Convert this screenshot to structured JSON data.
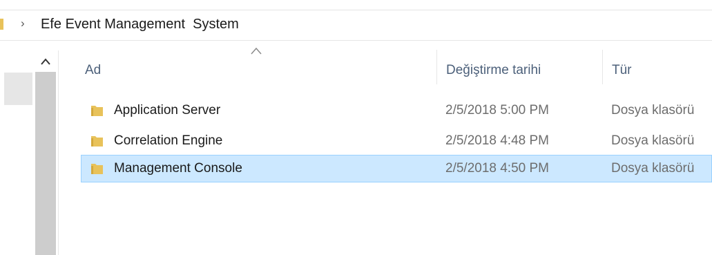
{
  "address_bar": {
    "path": "Efe Event Management  System"
  },
  "columns": {
    "name": "Ad",
    "modified": "Değiştirme tarihi",
    "type": "Tür"
  },
  "rows": [
    {
      "name": "Application Server",
      "modified": "2/5/2018 5:00 PM",
      "type": "Dosya klasörü",
      "selected": false
    },
    {
      "name": "Correlation Engine",
      "modified": "2/5/2018 4:48 PM",
      "type": "Dosya klasörü",
      "selected": false
    },
    {
      "name": "Management Console",
      "modified": "2/5/2018 4:50 PM",
      "type": "Dosya klasörü",
      "selected": true
    }
  ],
  "icons": {
    "address_chevron": "chevron-right-icon",
    "folder": "folder-icon",
    "sort": "sort-ascending-icon",
    "scroll_up": "scroll-up-arrow-icon"
  },
  "colors": {
    "selection_bg": "#cce8ff",
    "selection_border": "#99d1ff",
    "folder": "#e8c25a",
    "header_text": "#4c607a"
  }
}
